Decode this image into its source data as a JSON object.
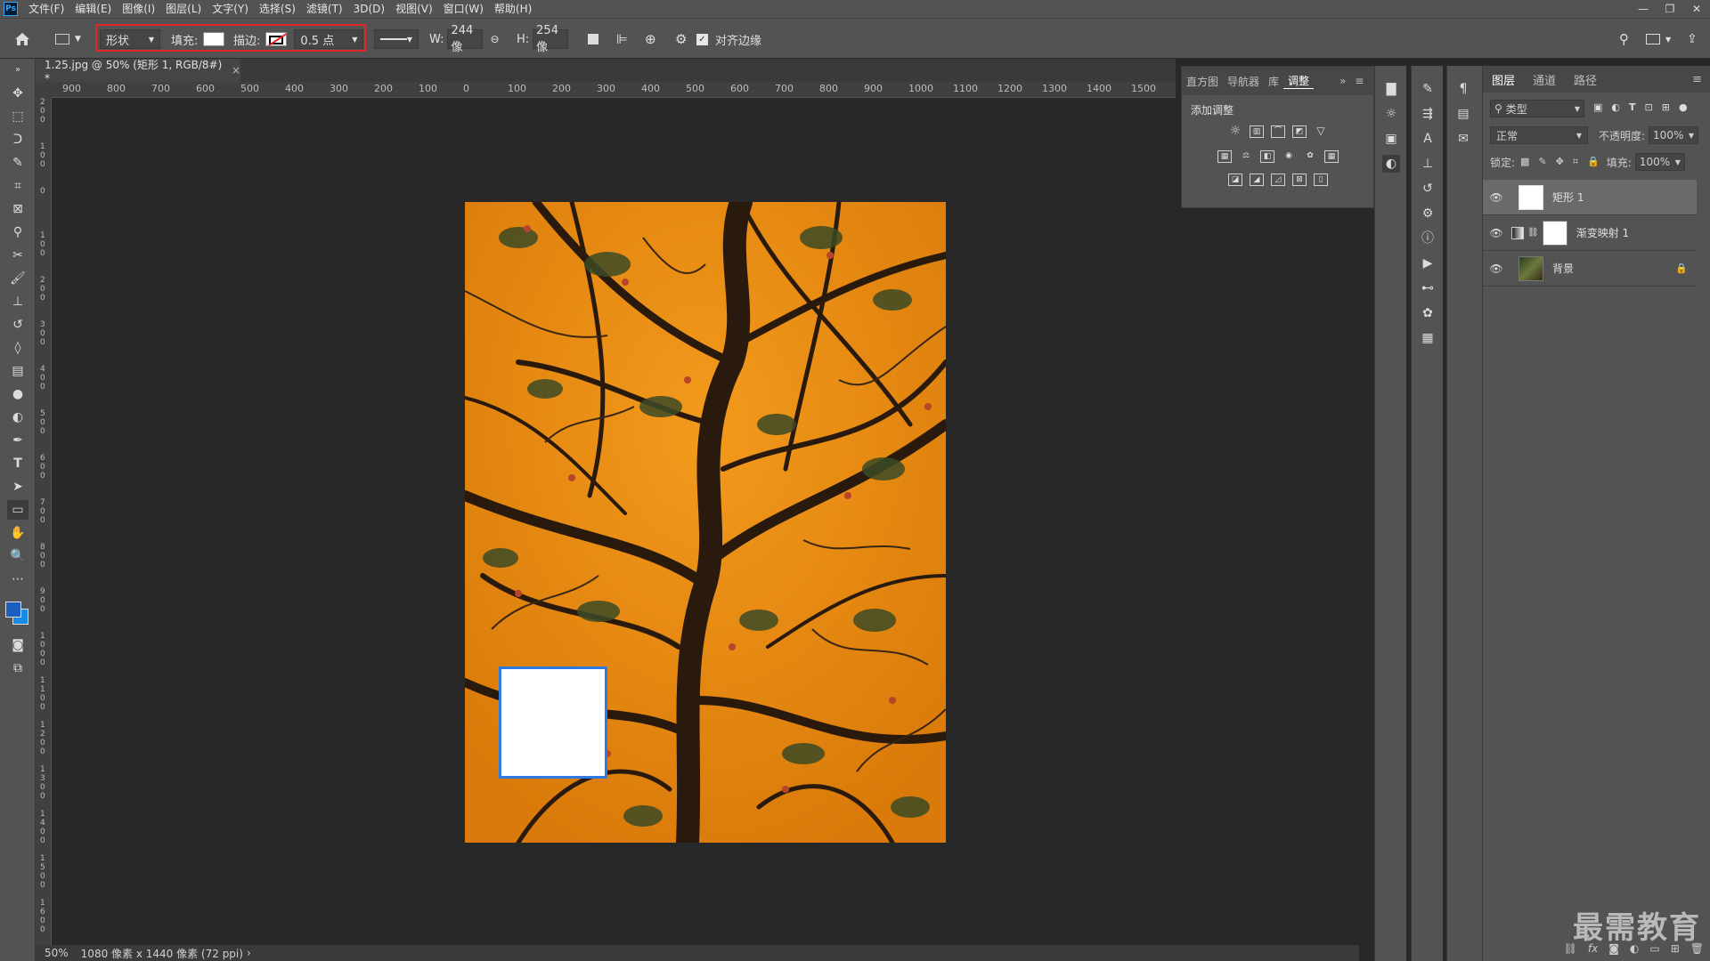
{
  "app": {
    "logo": "Ps"
  },
  "menu": [
    "文件(F)",
    "编辑(E)",
    "图像(I)",
    "图层(L)",
    "文字(Y)",
    "选择(S)",
    "滤镜(T)",
    "3D(D)",
    "视图(V)",
    "窗口(W)",
    "帮助(H)"
  ],
  "window_controls": [
    "—",
    "❐",
    "✕"
  ],
  "options": {
    "mode": "形状",
    "fill_label": "填充:",
    "fill_color": "#ffffff",
    "stroke_label": "描边:",
    "stroke_width": "0.5 点",
    "w_label": "W:",
    "w_value": "244 像",
    "h_label": "H:",
    "h_value": "254 像",
    "align_edges": "对齐边缘"
  },
  "document": {
    "tab_title": "1.25.jpg @ 50% (矩形 1, RGB/8#) *",
    "close": "×",
    "zoom": "50%",
    "info": "1080 像素 x 1440 像素 (72 ppi)"
  },
  "ruler": {
    "h_labels": [
      "900",
      "800",
      "700",
      "600",
      "500",
      "400",
      "300",
      "200",
      "100",
      "0",
      "100",
      "200",
      "300",
      "400",
      "500",
      "600",
      "700",
      "800",
      "900",
      "1000",
      "1100",
      "1200",
      "1300",
      "1400",
      "1500"
    ],
    "v_labels": [
      "2\n0\n0",
      "1\n0\n0",
      "0",
      "1\n0\n0",
      "2\n0\n0",
      "3\n0\n0",
      "4\n0\n0",
      "5\n0\n0",
      "6\n0\n0",
      "7\n0\n0",
      "8\n0\n0",
      "9\n0\n0",
      "1\n0\n0\n0",
      "1\n1\n0\n0",
      "1\n2\n0\n0",
      "1\n3\n0\n0",
      "1\n4\n0\n0",
      "1\n5\n0\n0",
      "1\n6\n0\n0"
    ]
  },
  "adjustments": {
    "tabs": [
      "直方图",
      "导航器",
      "库",
      "调整"
    ],
    "active_tab": "调整",
    "title": "添加调整"
  },
  "layers_panel": {
    "tabs": [
      "图层",
      "通道",
      "路径"
    ],
    "filter": "类型",
    "blend_mode": "正常",
    "opacity_label": "不透明度:",
    "opacity_value": "100%",
    "lock_label": "锁定:",
    "fill_label": "填充:",
    "fill_value": "100%",
    "layers": [
      {
        "name": "矩形 1",
        "selected": true
      },
      {
        "name": "渐变映射 1",
        "selected": false
      },
      {
        "name": "背景",
        "selected": false
      }
    ]
  },
  "watermark": "最需教育",
  "colors": {
    "accent_red": "#e3262b",
    "selection_blue": "#2f7ae0",
    "foreground": "#1c5fbf",
    "background": "#1a8ae6"
  }
}
